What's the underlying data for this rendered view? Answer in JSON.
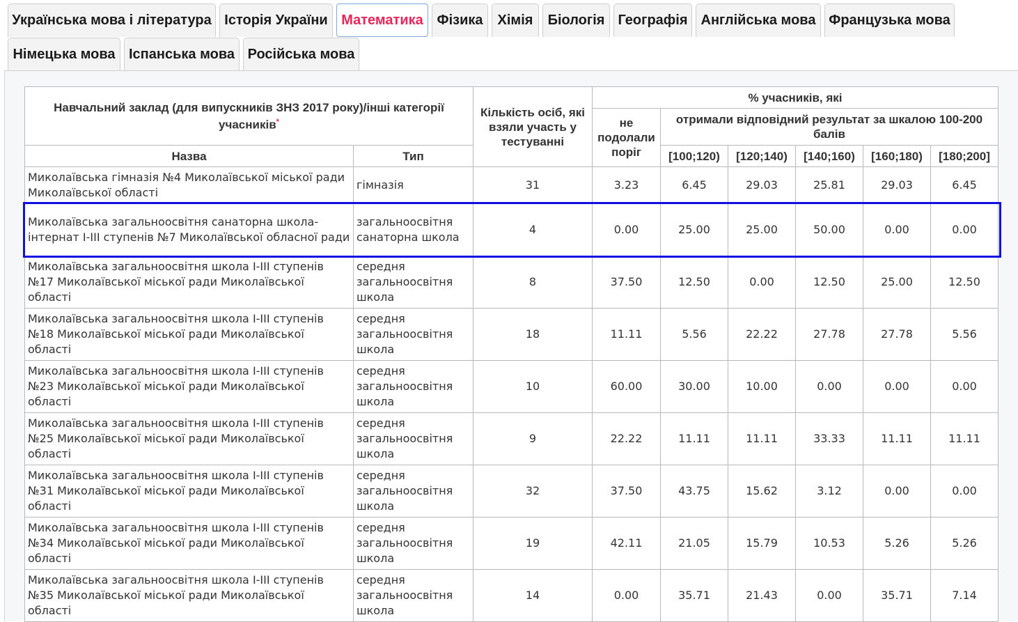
{
  "tabs": [
    {
      "label": "Українська мова і література",
      "active": false
    },
    {
      "label": "Історія України",
      "active": false
    },
    {
      "label": "Математика",
      "active": true
    },
    {
      "label": "Фізика",
      "active": false
    },
    {
      "label": "Хімія",
      "active": false
    },
    {
      "label": "Біологія",
      "active": false
    },
    {
      "label": "Географія",
      "active": false
    },
    {
      "label": "Англійська мова",
      "active": false
    },
    {
      "label": "Французька мова",
      "active": false
    },
    {
      "label": "Німецька мова",
      "active": false
    },
    {
      "label": "Іспанська мова",
      "active": false
    },
    {
      "label": "Російська мова",
      "active": false
    }
  ],
  "table": {
    "header": {
      "institution": "Навчальний заклад (для випускників ЗНЗ 2017 року)/інші категорії учасників",
      "required_mark": "*",
      "name": "Назва",
      "type": "Тип",
      "count": "Кількість осіб, які взяли участь у тестуванні",
      "percent": "% учасників, які",
      "not_passed": "не подолали поріг",
      "scale": "отримали відповідний результат за шкалою 100-200 балів",
      "ranges": [
        "[100;120)",
        "[120;140)",
        "[140;160)",
        "[160;180)",
        "[180;200]"
      ]
    },
    "rows": [
      {
        "name": "Миколаївська гімназія №4 Миколаївської міської ради Миколаївської області",
        "type": "гімназія",
        "count": "31",
        "not_passed": "3.23",
        "r1": "6.45",
        "r2": "29.03",
        "r3": "25.81",
        "r4": "29.03",
        "r5": "6.45"
      },
      {
        "name": "Миколаївська загальноосвітня санаторна школа-інтернат І-ІІІ ступенів №7 Миколаївської обласної ради",
        "type": "загальноосвітня санаторна школа",
        "count": "4",
        "not_passed": "0.00",
        "r1": "25.00",
        "r2": "25.00",
        "r3": "50.00",
        "r4": "0.00",
        "r5": "0.00"
      },
      {
        "name": "Миколаївська загальноосвітня школа І-ІІІ ступенів №17 Миколаївської міської ради Миколаївської області",
        "type": "середня загальноосвітня школа",
        "count": "8",
        "not_passed": "37.50",
        "r1": "12.50",
        "r2": "0.00",
        "r3": "12.50",
        "r4": "25.00",
        "r5": "12.50"
      },
      {
        "name": "Миколаївська загальноосвітня школа І-ІІІ ступенів №18 Миколаївської міської ради Миколаївської області",
        "type": "середня загальноосвітня школа",
        "count": "18",
        "not_passed": "11.11",
        "r1": "5.56",
        "r2": "22.22",
        "r3": "27.78",
        "r4": "27.78",
        "r5": "5.56"
      },
      {
        "name": "Миколаївська загальноосвітня школа І-ІІІ ступенів №23 Миколаївської міської ради Миколаївської області",
        "type": "середня загальноосвітня школа",
        "count": "10",
        "not_passed": "60.00",
        "r1": "30.00",
        "r2": "10.00",
        "r3": "0.00",
        "r4": "0.00",
        "r5": "0.00"
      },
      {
        "name": "Миколаївська загальноосвітня школа І-ІІІ ступенів №25 Миколаївської міської ради Миколаївської області",
        "type": "середня загальноосвітня школа",
        "count": "9",
        "not_passed": "22.22",
        "r1": "11.11",
        "r2": "11.11",
        "r3": "33.33",
        "r4": "11.11",
        "r5": "11.11"
      },
      {
        "name": "Миколаївська загальноосвітня школа І-ІІІ ступенів №31 Миколаївської міської ради Миколаївської області",
        "type": "середня загальноосвітня школа",
        "count": "32",
        "not_passed": "37.50",
        "r1": "43.75",
        "r2": "15.62",
        "r3": "3.12",
        "r4": "0.00",
        "r5": "0.00"
      },
      {
        "name": "Миколаївська загальноосвітня школа І-ІІІ ступенів №34 Миколаївської міської ради Миколаївської області",
        "type": "середня загальноосвітня школа",
        "count": "19",
        "not_passed": "42.11",
        "r1": "21.05",
        "r2": "15.79",
        "r3": "10.53",
        "r4": "5.26",
        "r5": "5.26"
      },
      {
        "name": "Миколаївська загальноосвітня школа І-ІІІ ступенів №35 Миколаївської міської ради Миколаївської області",
        "type": "середня загальноосвітня школа",
        "count": "14",
        "not_passed": "0.00",
        "r1": "35.71",
        "r2": "21.43",
        "r3": "0.00",
        "r4": "35.71",
        "r5": "7.14"
      }
    ]
  }
}
